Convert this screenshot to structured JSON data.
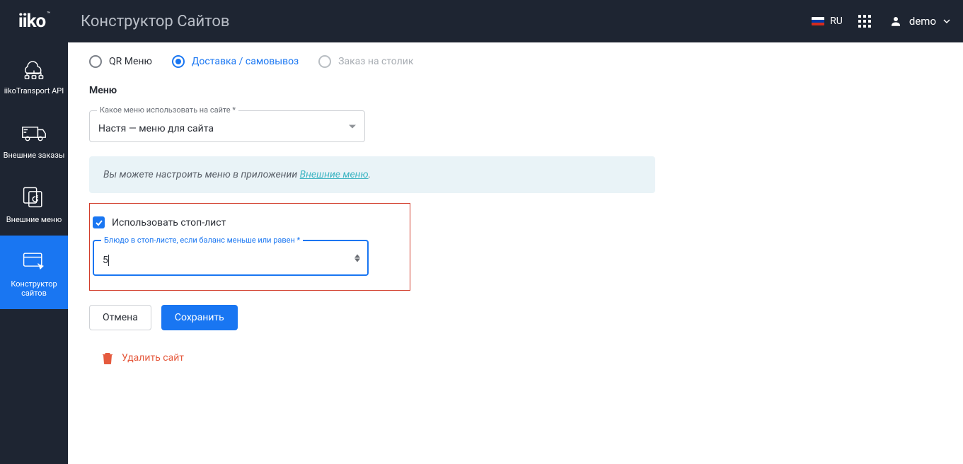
{
  "header": {
    "logo": "iiko",
    "tm": "™",
    "page_title": "Конструктор Сайтов",
    "lang": "RU",
    "user": "demo"
  },
  "sidebar": {
    "items": [
      {
        "label": "iikoTransport API"
      },
      {
        "label": "Внешние заказы"
      },
      {
        "label": "Внешние меню"
      },
      {
        "label": "Конструктор сайтов"
      }
    ]
  },
  "tabs": [
    {
      "label": "QR Меню",
      "state": "normal"
    },
    {
      "label": "Доставка / самовывоз",
      "state": "selected"
    },
    {
      "label": "Заказ на столик",
      "state": "disabled"
    }
  ],
  "menu_section": {
    "title": "Меню",
    "select_label": "Какое меню использовать на сайте *",
    "select_value": "Настя — меню для сайта",
    "banner_text_prefix": "Вы можете настроить меню в приложении ",
    "banner_link": "Внешние меню",
    "checkbox_label": "Использовать стоп-лист",
    "num_label": "Блюдо в стоп-листе, если баланс меньше или равен *",
    "num_value": "5"
  },
  "actions": {
    "cancel": "Отмена",
    "save": "Сохранить",
    "delete": "Удалить сайт"
  }
}
